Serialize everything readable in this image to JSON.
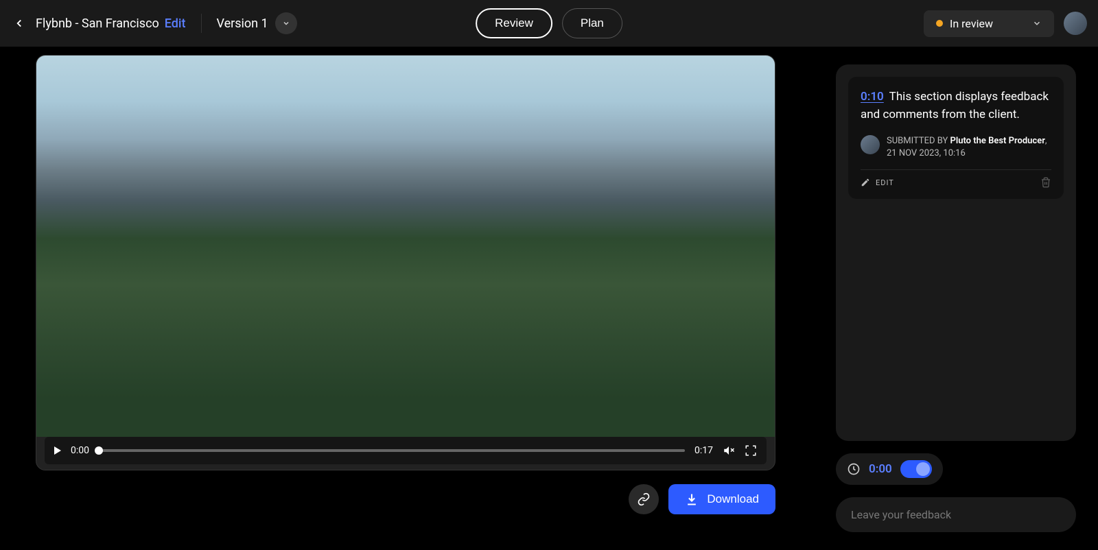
{
  "header": {
    "title": "Flybnb - San Francisco",
    "edit_label": "Edit",
    "version": "Version 1",
    "review_label": "Review",
    "plan_label": "Plan",
    "status_label": "In review"
  },
  "video": {
    "current_time": "0:00",
    "duration": "0:17"
  },
  "actions": {
    "download_label": "Download"
  },
  "comment": {
    "timestamp": "0:10",
    "text": "This section displays feedback and comments from the client.",
    "submitted_by_prefix": "SUBMITTED BY ",
    "author": "Pluto the Best Producer",
    "separator": ", ",
    "date": "21 NOV 2023, 10:16",
    "edit_label": "EDIT"
  },
  "timebar": {
    "time": "0:00"
  },
  "feedback": {
    "placeholder": "Leave your feedback"
  }
}
